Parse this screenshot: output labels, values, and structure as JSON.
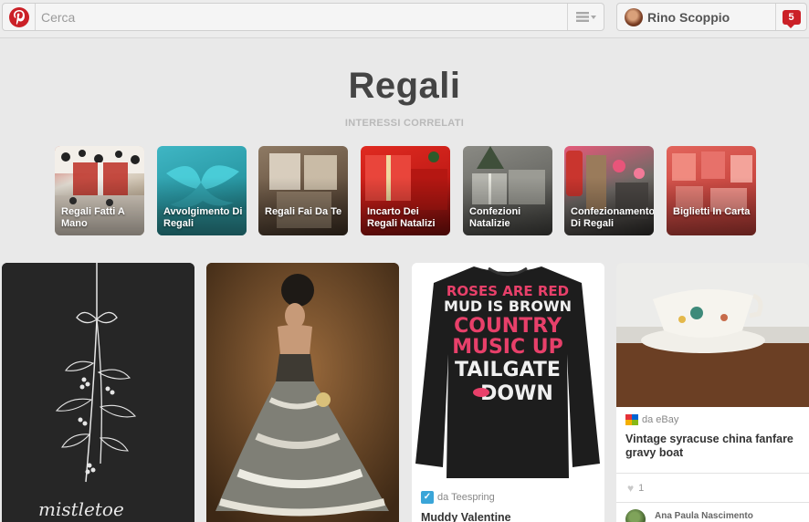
{
  "header": {
    "search_placeholder": "Cerca",
    "user_name": "Rino Scoppio",
    "notification_count": "5"
  },
  "page": {
    "title": "Regali",
    "related_label": "INTERESSI CORRELATI"
  },
  "interests": [
    {
      "label": "Regali Fatti A Mano"
    },
    {
      "label": "Avvolgimento Di Regali"
    },
    {
      "label": "Regali Fai Da Te"
    },
    {
      "label": "Incarto Dei Regali Natalizi"
    },
    {
      "label": "Confezioni Natalizie"
    },
    {
      "label": "Confezionamento Di Regali"
    },
    {
      "label": "Biglietti In Carta"
    }
  ],
  "pins": [
    {
      "image_text": "mistletoe"
    },
    {
      "image_text": ""
    },
    {
      "image_lines": [
        "ROSES ARE RED",
        "MUD IS BROWN",
        "COUNTRY",
        "MUSIC UP",
        "TAILGATE",
        "DOWN"
      ],
      "source": "da Teespring",
      "title": "Muddy Valentine"
    },
    {
      "source": "da eBay",
      "title": "Vintage syracuse china fanfare gravy boat",
      "likes": "1",
      "pinner": "Ana Paula Nascimento"
    }
  ],
  "colors": {
    "brand_red": "#cb2027",
    "background": "#e9e9e9"
  }
}
